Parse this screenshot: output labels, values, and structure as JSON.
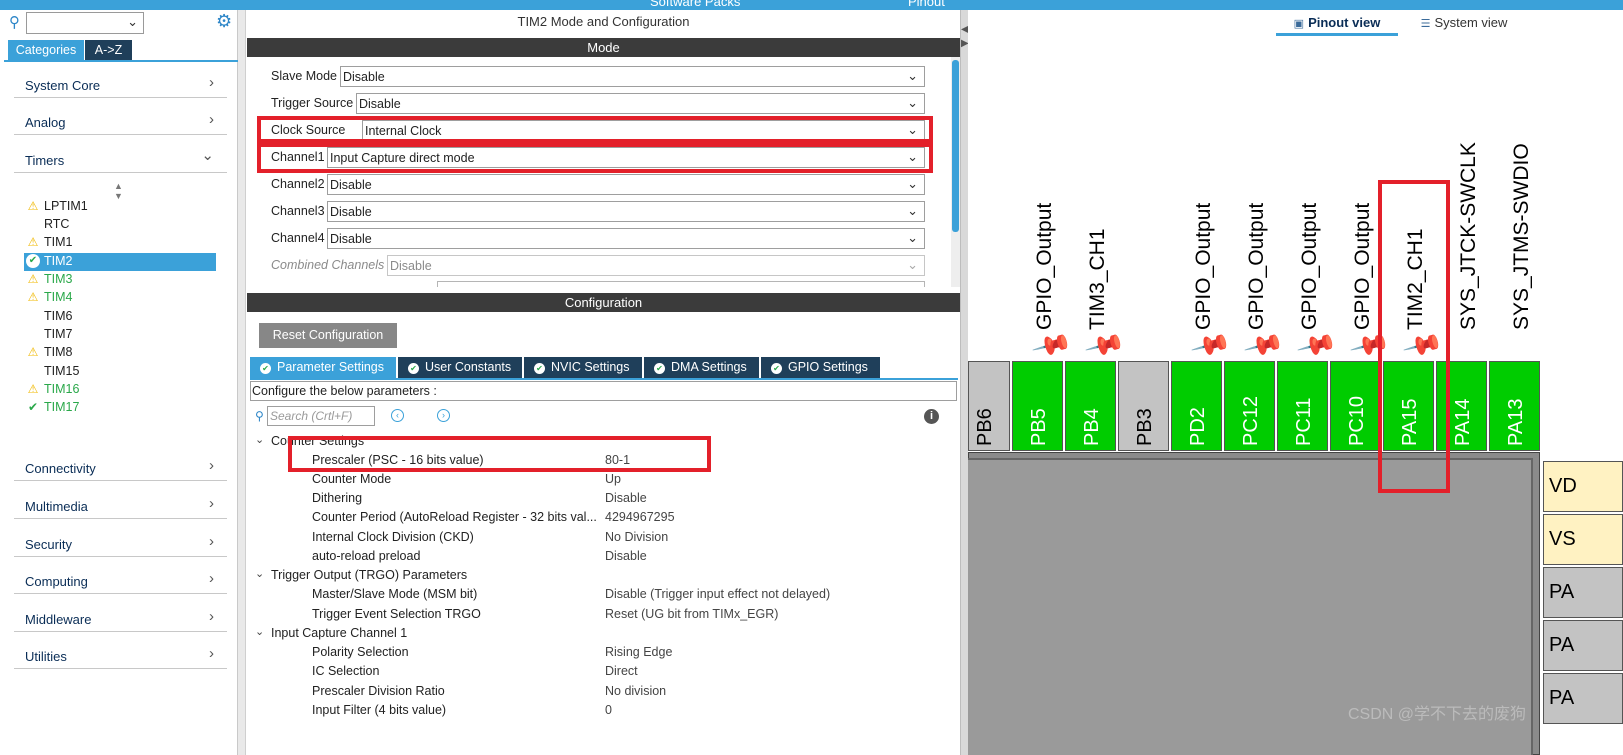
{
  "topbar": {
    "left_cut": "Software Packs",
    "right_cut": "Pinout"
  },
  "left": {
    "tabs": [
      "Categories",
      "A->Z"
    ],
    "categories": [
      "System Core",
      "Analog",
      "Timers",
      "Connectivity",
      "Multimedia",
      "Security",
      "Computing",
      "Middleware",
      "Utilities"
    ],
    "timers": [
      {
        "name": "LPTIM1",
        "status": "warning"
      },
      {
        "name": "RTC",
        "status": "none"
      },
      {
        "name": "TIM1",
        "status": "warning"
      },
      {
        "name": "TIM2",
        "status": "ok-selected"
      },
      {
        "name": "TIM3",
        "status": "warning-configured"
      },
      {
        "name": "TIM4",
        "status": "warning-configured"
      },
      {
        "name": "TIM6",
        "status": "none"
      },
      {
        "name": "TIM7",
        "status": "none"
      },
      {
        "name": "TIM8",
        "status": "warning"
      },
      {
        "name": "TIM15",
        "status": "none"
      },
      {
        "name": "TIM16",
        "status": "warning-configured"
      },
      {
        "name": "TIM17",
        "status": "ok-configured"
      }
    ]
  },
  "mid": {
    "title": "TIM2 Mode and Configuration",
    "mode_band": "Mode",
    "config_band": "Configuration",
    "mode_rows": [
      {
        "label": "Slave Mode",
        "value": "Disable"
      },
      {
        "label": "Trigger Source",
        "value": "Disable"
      },
      {
        "label": "Clock Source",
        "value": "Internal Clock"
      },
      {
        "label": "Channel1",
        "value": "Input Capture direct mode"
      },
      {
        "label": "Channel2",
        "value": "Disable"
      },
      {
        "label": "Channel3",
        "value": "Disable"
      },
      {
        "label": "Channel4",
        "value": "Disable"
      },
      {
        "label": "Combined Channels",
        "value": "Disable"
      }
    ],
    "reset_button": "Reset Configuration",
    "tabs": [
      "Parameter Settings",
      "User Constants",
      "NVIC Settings",
      "DMA Settings",
      "GPIO Settings"
    ],
    "configure_text": "Configure the below parameters :",
    "search_placeholder": "Search (Crtl+F)",
    "groups": [
      {
        "title": "Counter Settings",
        "params": [
          {
            "k": "Prescaler (PSC - 16 bits value)",
            "v": "80-1"
          },
          {
            "k": "Counter Mode",
            "v": "Up"
          },
          {
            "k": "Dithering",
            "v": "Disable"
          },
          {
            "k": "Counter Period (AutoReload Register - 32 bits val...",
            "v": "4294967295"
          },
          {
            "k": "Internal Clock Division (CKD)",
            "v": "No Division"
          },
          {
            "k": "auto-reload preload",
            "v": "Disable"
          }
        ]
      },
      {
        "title": "Trigger Output (TRGO) Parameters",
        "params": [
          {
            "k": "Master/Slave Mode (MSM bit)",
            "v": "Disable (Trigger input effect not delayed)"
          },
          {
            "k": "Trigger Event Selection TRGO",
            "v": "Reset (UG bit from TIMx_EGR)"
          }
        ]
      },
      {
        "title": "Input Capture Channel 1",
        "params": [
          {
            "k": "Polarity Selection",
            "v": "Rising Edge"
          },
          {
            "k": "IC Selection",
            "v": "Direct"
          },
          {
            "k": "Prescaler Division Ratio",
            "v": "No division"
          },
          {
            "k": "Input Filter (4 bits value)",
            "v": "0"
          }
        ]
      }
    ]
  },
  "right": {
    "view_tabs": [
      "Pinout view",
      "System view"
    ],
    "pins": [
      {
        "name": "PB6",
        "signal": "",
        "color": "gray"
      },
      {
        "name": "PB5",
        "signal": "GPIO_Output",
        "color": "green"
      },
      {
        "name": "PB4",
        "signal": "TIM3_CH1",
        "color": "green"
      },
      {
        "name": "PB3",
        "signal": "",
        "color": "gray"
      },
      {
        "name": "PD2",
        "signal": "GPIO_Output",
        "color": "green"
      },
      {
        "name": "PC12",
        "signal": "GPIO_Output",
        "color": "green"
      },
      {
        "name": "PC11",
        "signal": "GPIO_Output",
        "color": "green"
      },
      {
        "name": "PC10",
        "signal": "GPIO_Output",
        "color": "green"
      },
      {
        "name": "PA15",
        "signal": "TIM2_CH1",
        "color": "green"
      },
      {
        "name": "PA14",
        "signal": "SYS_JTCK-SWCLK",
        "color": "green"
      },
      {
        "name": "PA13",
        "signal": "SYS_JTMS-SWDIO",
        "color": "green"
      }
    ],
    "side_pins": [
      "VD",
      "VS",
      "PA",
      "PA",
      "PA"
    ],
    "watermark": "CSDN @学不下去的废狗"
  },
  "colors": {
    "accent": "#3ba1d9",
    "dark": "#1f3f5a",
    "pin_green": "#00cc00",
    "highlight": "#e3202a"
  }
}
